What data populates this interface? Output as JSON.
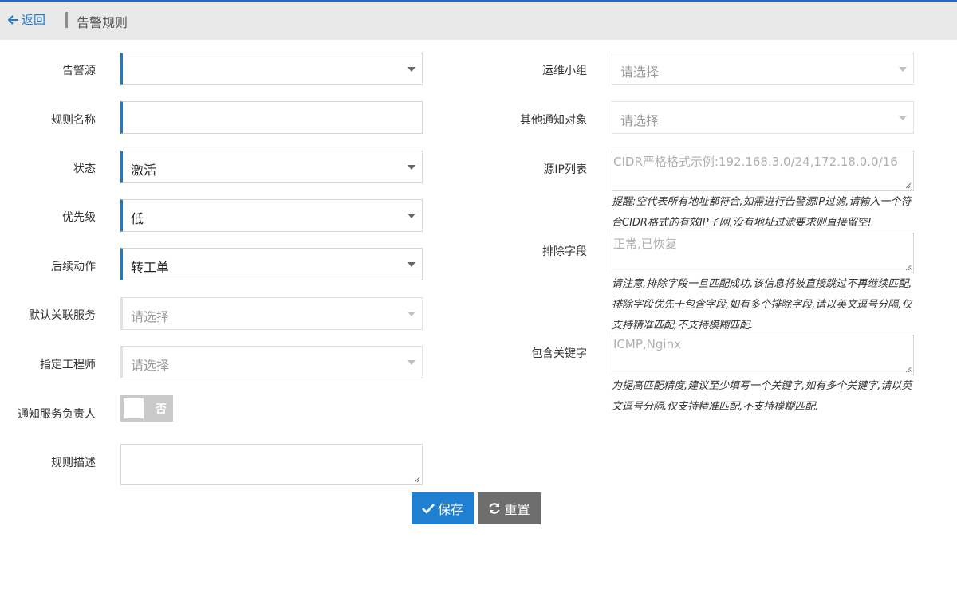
{
  "header": {
    "back_label": "返回",
    "title": "告警规则"
  },
  "left_form": {
    "alert_source": {
      "label": "告警源",
      "value": ""
    },
    "rule_name": {
      "label": "规则名称",
      "value": ""
    },
    "status": {
      "label": "状态",
      "value": "激活"
    },
    "priority": {
      "label": "优先级",
      "value": "低"
    },
    "follow_up": {
      "label": "后续动作",
      "value": "转工单"
    },
    "default_service": {
      "label": "默认关联服务",
      "placeholder": "请选择"
    },
    "engineer": {
      "label": "指定工程师",
      "placeholder": "请选择"
    },
    "notify_owner": {
      "label": "通知服务负责人",
      "toggle_text": "否"
    },
    "description": {
      "label": "规则描述",
      "value": ""
    }
  },
  "right_form": {
    "ops_group": {
      "label": "运维小组",
      "placeholder": "请选择"
    },
    "other_notify": {
      "label": "其他通知对象",
      "placeholder": "请选择"
    },
    "source_ip": {
      "label": "源IP列表",
      "placeholder": "CIDR严格格式示例:192.168.3.0/24,172.18.0.0/16",
      "hint": "提醒:空代表所有地址都符合,如需进行告警源IP过滤,请输入一个符合CIDR格式的有效IP子网,没有地址过滤要求则直接留空!"
    },
    "exclude_fields": {
      "label": "排除字段",
      "placeholder": "正常,已恢复",
      "hint": "请注意,排除字段一旦匹配成功,该信息将被直接跳过不再继续匹配,排除字段优先于包含字段,如有多个排除字段,请以英文逗号分隔,仅支持精准匹配,不支持模糊匹配."
    },
    "include_keywords": {
      "label": "包含关键字",
      "placeholder": "ICMP,Nginx",
      "hint": "为提高匹配精度,建议至少填写一个关键字,如有多个关键字,请以英文逗号分隔,仅支持精准匹配,不支持模糊匹配."
    }
  },
  "actions": {
    "save_label": "保存",
    "reset_label": "重置"
  },
  "colors": {
    "accent": "#1f7bc9",
    "save_bg": "#1f7fd0",
    "reset_bg": "#6e6e6e",
    "header_bg": "#e9e9e9"
  }
}
